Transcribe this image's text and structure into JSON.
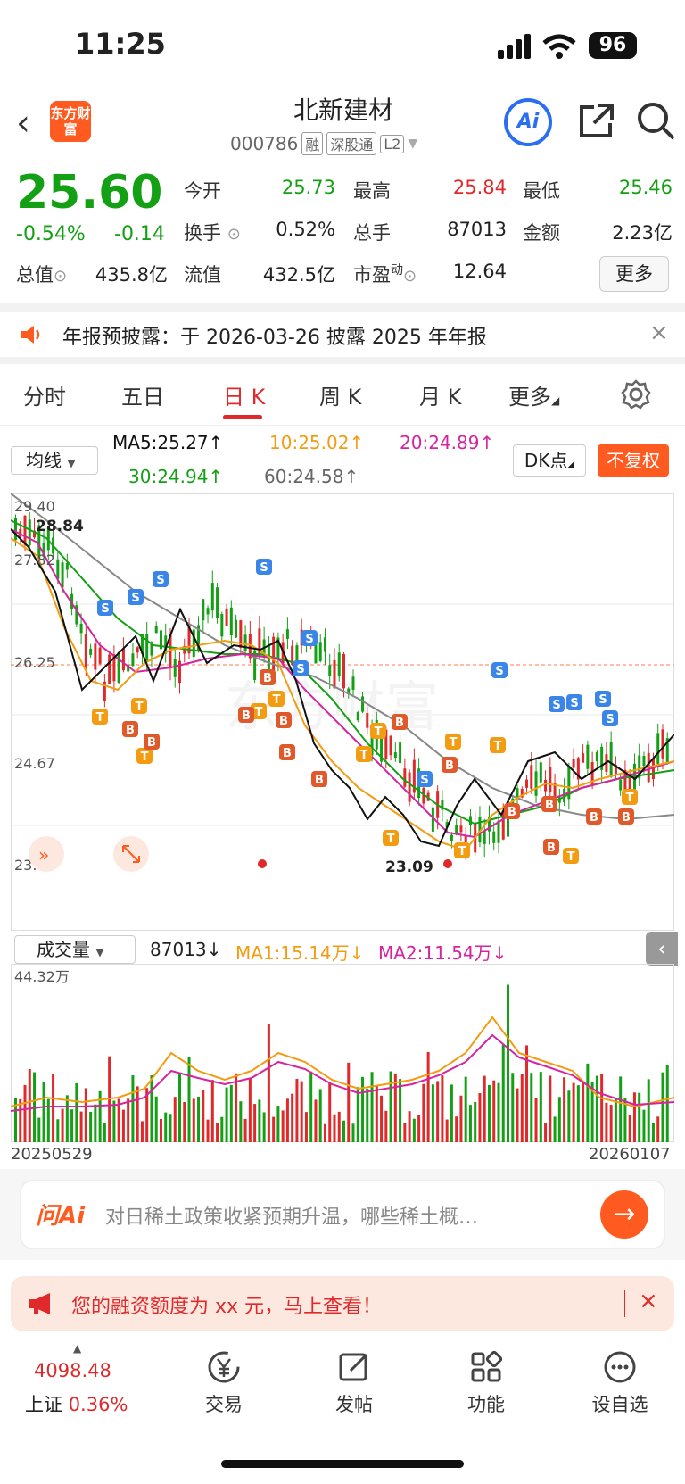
{
  "status": {
    "time": "11:25",
    "battery": "96"
  },
  "header": {
    "logo": "东方财富",
    "name": "北新建材",
    "code": "000786",
    "tags": [
      "融",
      "深股通",
      "L2"
    ],
    "ai": "Ai"
  },
  "quote": {
    "price": "25.60",
    "pct": "-0.54%",
    "chg": "-0.14",
    "rows": [
      [
        {
          "l": "今开",
          "v": "25.73",
          "c": "green"
        },
        {
          "l": "最高",
          "v": "25.84",
          "c": "red"
        },
        {
          "l": "最低",
          "v": "25.46",
          "c": "green"
        }
      ],
      [
        {
          "l": "换手",
          "v": "0.52%",
          "c": ""
        },
        {
          "l": "总手",
          "v": "87013",
          "c": ""
        },
        {
          "l": "金额",
          "v": "2.23亿",
          "c": ""
        }
      ],
      [
        {
          "l": "总值",
          "v": "435.8亿",
          "c": ""
        },
        {
          "l": "流值",
          "v": "432.5亿",
          "c": ""
        },
        {
          "l": "市盈",
          "v": "12.64",
          "c": ""
        }
      ]
    ],
    "pe_sup": "动",
    "more": "更多"
  },
  "notice": {
    "text": "年报预披露：于 2026-03-26 披露 2025 年年报",
    "close": "×"
  },
  "tabs": [
    "分时",
    "五日",
    "日 K",
    "周 K",
    "月 K",
    "更多"
  ],
  "ma": {
    "select": "均线",
    "ma5": "MA5:25.27↑",
    "ma10": "10:25.02↑",
    "ma20": "20:24.89↑",
    "ma30": "30:24.94↑",
    "ma60": "60:24.58↑",
    "dk": "DK点",
    "fq": "不复权"
  },
  "kline": {
    "y_labels": [
      "29.40",
      "27.82",
      "26.25",
      "24.67",
      "23.05"
    ],
    "high_mark": "28.84",
    "low_mark": "23.09",
    "watermark": "东方财富"
  },
  "volume": {
    "select": "成交量",
    "vol": "87013↓",
    "ma1": "MA1:15.14万↓",
    "ma2": "MA2:11.54万↓",
    "max_label": "44.32万",
    "date_start": "20250529",
    "date_end": "20260107"
  },
  "ask": {
    "logo": "问Ai",
    "text": "对日稀土政策收紧预期升温，哪些稀土概…"
  },
  "promo": {
    "text": "您的融资额度为 xx 元，马上查看！"
  },
  "nav": {
    "index_value": "4098.48",
    "index_name": "上证",
    "index_pct": "0.36%",
    "items": [
      "交易",
      "发帖",
      "功能",
      "设自选"
    ]
  },
  "colors": {
    "up": "#e0292a",
    "down": "#14a014",
    "accent": "#ff5a1f",
    "ma5": "#111111",
    "ma10": "#f39c12",
    "ma20": "#d6249f",
    "ma30": "#14a014",
    "ma60": "#888888"
  }
}
